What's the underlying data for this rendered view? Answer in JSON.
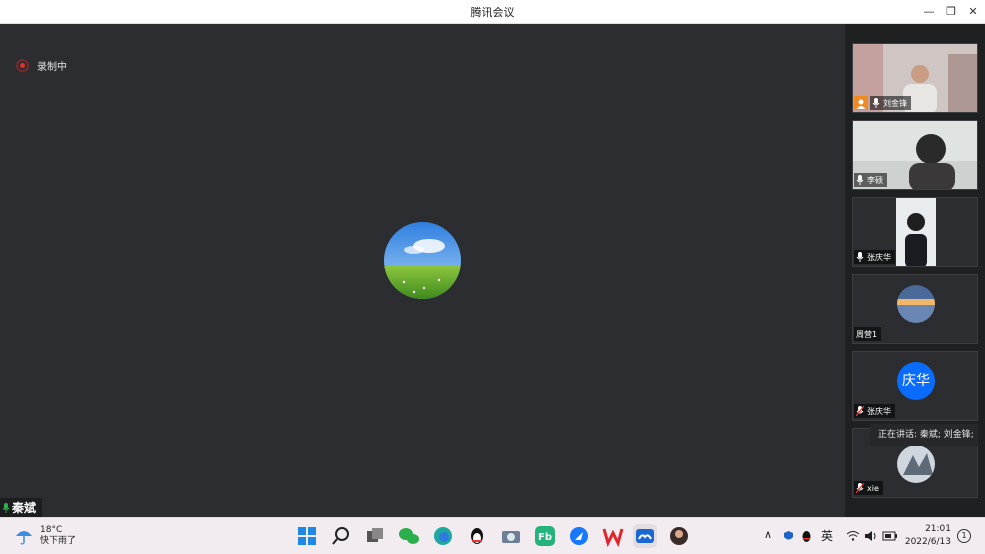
{
  "window": {
    "title": "腾讯会议"
  },
  "recording": {
    "label": "录制中"
  },
  "self": {
    "name": "秦斌"
  },
  "participants": [
    {
      "name": "刘金锋",
      "type": "video"
    },
    {
      "name": "李硕",
      "type": "video"
    },
    {
      "name": "张庆华",
      "type": "video"
    },
    {
      "name": "周营1",
      "type": "avatar"
    },
    {
      "name": "张庆华",
      "type": "initials",
      "initials": "庆华"
    },
    {
      "name": "xie",
      "type": "avatar"
    }
  ],
  "speaking": {
    "text": "正在讲话: 秦斌; 刘金锋;"
  },
  "taskbar": {
    "weather_temp": "18°C",
    "weather_desc": "快下雨了",
    "ime": "英",
    "time": "21:01",
    "date": "2022/6/13",
    "notifications": "1"
  },
  "colors": {
    "accent": "#0a6cff",
    "mic_green": "#2fb24a",
    "rec_red": "#dd3333"
  }
}
